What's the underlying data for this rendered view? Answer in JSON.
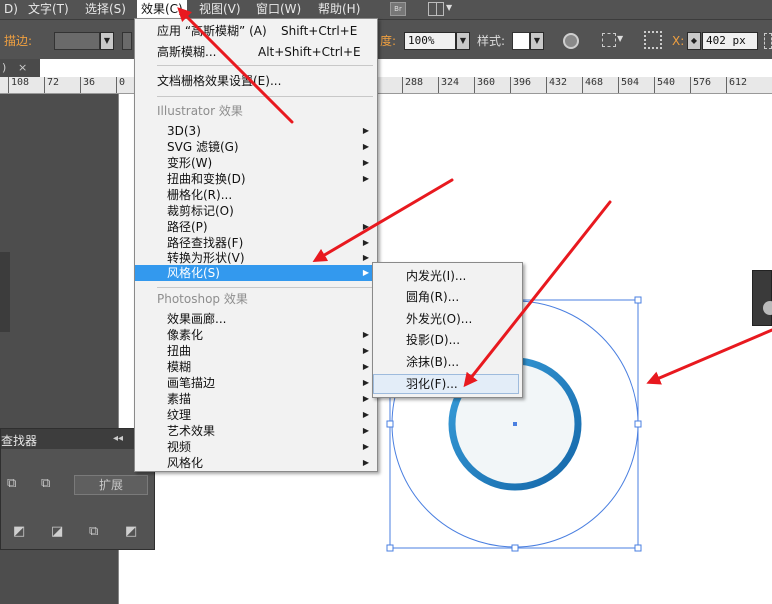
{
  "menubar": {
    "items": [
      {
        "label": "D)",
        "x": 0
      },
      {
        "label": "文字(T)",
        "x": 0
      },
      {
        "label": "选择(S)",
        "x": 0
      },
      {
        "label": "效果(C)",
        "x": 0
      },
      {
        "label": "视图(V)",
        "x": 0
      },
      {
        "label": "窗口(W)",
        "x": 0
      },
      {
        "label": "帮助(H)",
        "x": 0
      }
    ],
    "bridge_badge": "Br"
  },
  "controlbar": {
    "stroke_label": "描边:",
    "opacity_label": "度:",
    "opacity_value": "100%",
    "style_label": "样式:",
    "x_label": "X:",
    "x_value": "402 px"
  },
  "doc_tab": {
    "label": ")",
    "close": "×"
  },
  "ruler_ticks": [
    "108",
    "72",
    "36",
    "0",
    "288",
    "324",
    "360",
    "396",
    "432",
    "468",
    "504",
    "540",
    "576",
    "612"
  ],
  "effect_menu": {
    "apply_label": "应用 “高斯模糊” (A)",
    "apply_shortcut": "Shift+Ctrl+E",
    "gaussian_label": "高斯模糊...",
    "gaussian_shortcut": "Alt+Shift+Ctrl+E",
    "raster_settings": "文档栅格效果设置(E)...",
    "illustrator_section": "Illustrator 效果",
    "illustrator_items": [
      {
        "label": "3D(3)",
        "submenu": true
      },
      {
        "label": "SVG 滤镜(G)",
        "submenu": true
      },
      {
        "label": "变形(W)",
        "submenu": true
      },
      {
        "label": "扭曲和变换(D)",
        "submenu": true
      },
      {
        "label": "栅格化(R)...",
        "submenu": false
      },
      {
        "label": "裁剪标记(O)",
        "submenu": false
      },
      {
        "label": "路径(P)",
        "submenu": true
      },
      {
        "label": "路径查找器(F)",
        "submenu": true
      },
      {
        "label": "转换为形状(V)",
        "submenu": true
      },
      {
        "label": "风格化(S)",
        "submenu": true
      }
    ],
    "photoshop_section": "Photoshop 效果",
    "photoshop_items": [
      {
        "label": "效果画廊...",
        "submenu": false
      },
      {
        "label": "像素化",
        "submenu": true
      },
      {
        "label": "扭曲",
        "submenu": true
      },
      {
        "label": "模糊",
        "submenu": true
      },
      {
        "label": "画笔描边",
        "submenu": true
      },
      {
        "label": "素描",
        "submenu": true
      },
      {
        "label": "纹理",
        "submenu": true
      },
      {
        "label": "艺术效果",
        "submenu": true
      },
      {
        "label": "视频",
        "submenu": true
      },
      {
        "label": "风格化",
        "submenu": true
      }
    ],
    "highlighted": "风格化(S)"
  },
  "stylize_submenu": {
    "items": [
      "内发光(I)...",
      "圆角(R)...",
      "外发光(O)...",
      "投影(D)...",
      "涂抹(B)...",
      "羽化(F)..."
    ],
    "hovered": "羽化(F)..."
  },
  "pathfinder_panel": {
    "title": "查找器",
    "expand_label": "扩展",
    "collapse_glyph": "◂◂"
  },
  "colors": {
    "ui_dark": "#535353",
    "menu_highlight": "#3399ee",
    "ring_blue": "#1f88cc",
    "annotation_red": "#e8191f",
    "selection_blue": "#4a7fe0"
  }
}
